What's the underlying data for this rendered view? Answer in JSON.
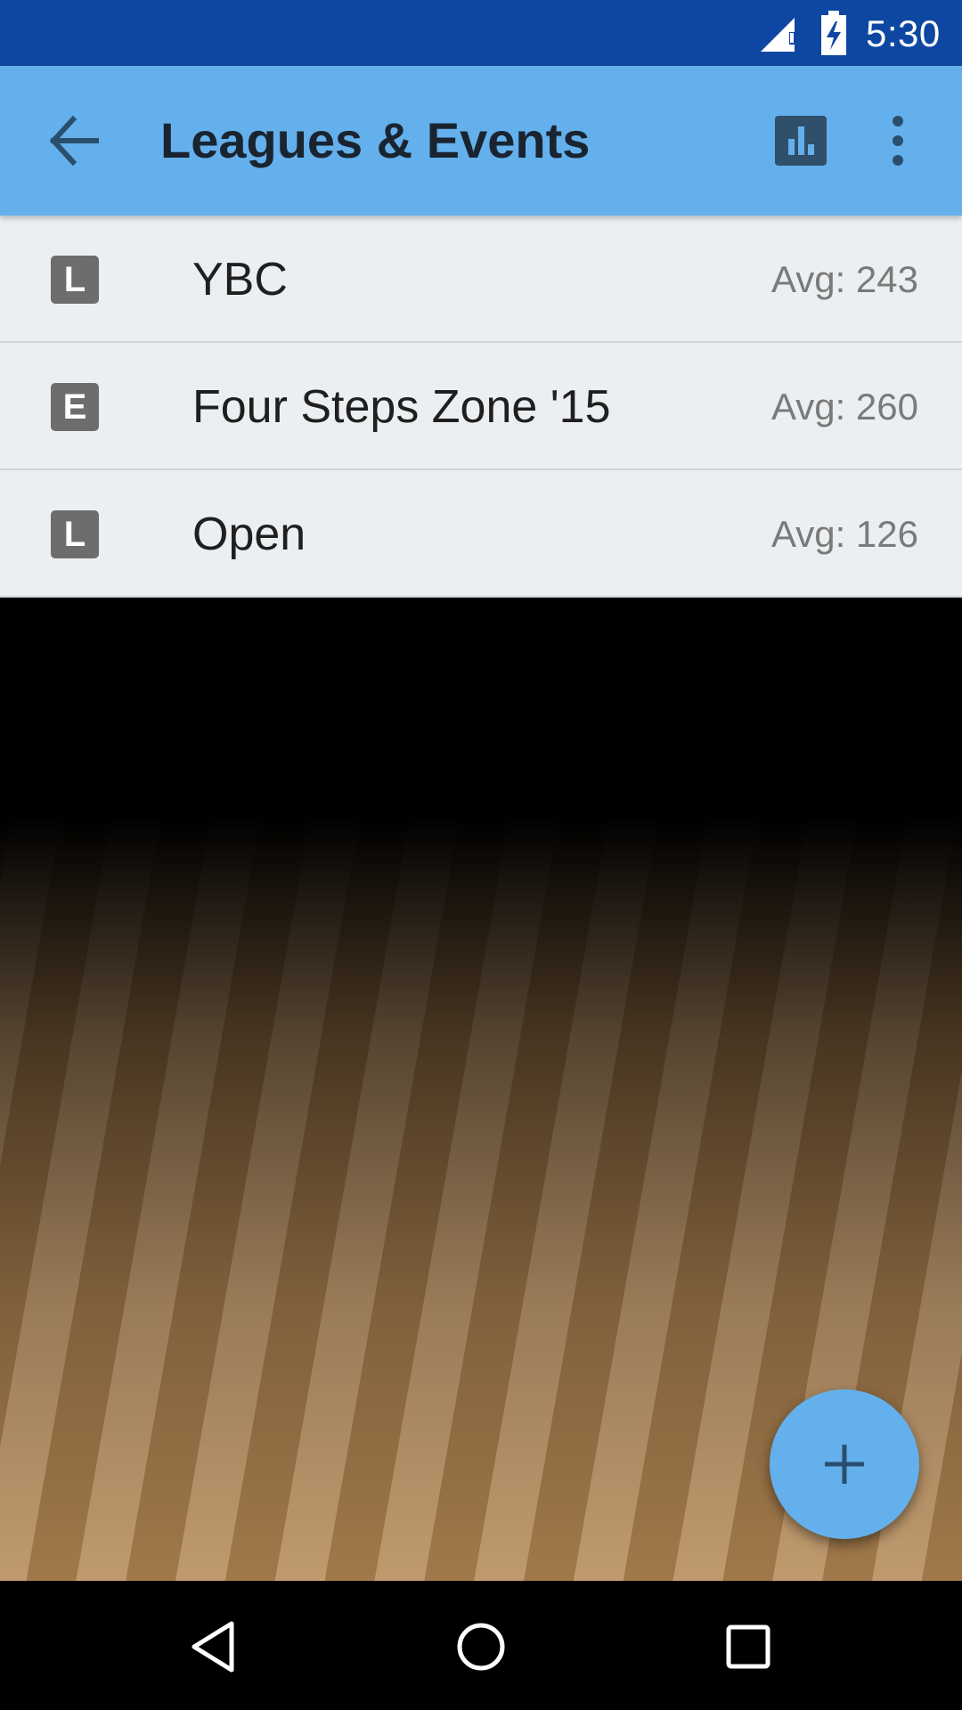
{
  "status_bar": {
    "time": "5:30",
    "icons": [
      "signal-icon",
      "battery-charging-icon"
    ]
  },
  "app_bar": {
    "title": "Leagues & Events",
    "color": "#64b0ec",
    "actions": [
      "back-arrow-icon",
      "stats-chart-icon",
      "more-vert-icon"
    ]
  },
  "list": {
    "items": [
      {
        "badge": "L",
        "name": "YBC",
        "avg": "Avg: 243"
      },
      {
        "badge": "E",
        "name": "Four Steps Zone '15",
        "avg": "Avg: 260"
      },
      {
        "badge": "L",
        "name": "Open",
        "avg": "Avg: 126"
      }
    ]
  },
  "fab": {
    "icon": "plus-icon",
    "color": "#64b0ec"
  },
  "nav_bar": {
    "icons": [
      "nav-back-icon",
      "nav-home-icon",
      "nav-recents-icon"
    ]
  }
}
